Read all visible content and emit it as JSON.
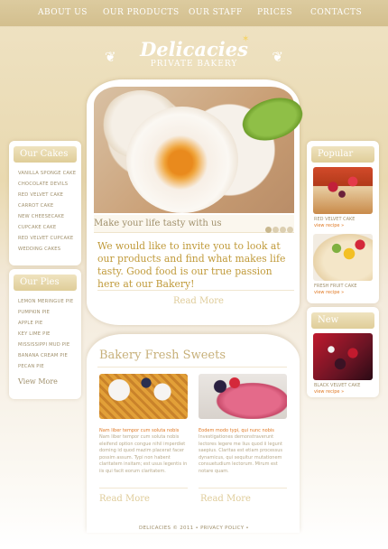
{
  "nav": [
    "ABOUT US",
    "OUR PRODUCTS",
    "OUR STAFF",
    "PRICES",
    "CONTACTS"
  ],
  "logo": {
    "title": "Delicacies",
    "subtitle": "PRIVATE BAKERY"
  },
  "cakes": {
    "heading": "Our Cakes",
    "items": [
      "VANILLA SPONGE CAKE",
      "CHOCOLATE DEVILS",
      "RED VELVET CAKE",
      "CARROT CAKE",
      "NEW CHEESECAKE",
      "CUPCAKE CAKE",
      "RED VELVET CUPCAKE",
      "WEDDING CAKES"
    ]
  },
  "pies": {
    "heading": "Our Pies",
    "items": [
      "LEMON MERINGUE PIE",
      "PUMPKIN PIE",
      "APPLE PIE",
      "KEY LIME PIE",
      "MISSISSIPPI MUD PIE",
      "BANANA CREAM PIE",
      "PECAN PIE"
    ],
    "more": "View More"
  },
  "popular": {
    "heading": "Popular",
    "items": [
      {
        "caption": "RED VELVET CAKE",
        "link": "view recipe »"
      },
      {
        "caption": "FRESH FRUIT CAKE",
        "link": "view recipe »"
      }
    ]
  },
  "new": {
    "heading": "New",
    "items": [
      {
        "caption": "BLACK VELVET CAKE",
        "link": "view recipe »"
      }
    ]
  },
  "hero": {
    "tagline": "Make your life tasty with us",
    "intro": "We would like to invite you to look at our products and find what makes life tasty. Good food is our true passion here at our Bakery!",
    "read_more": "Read More"
  },
  "sweets": {
    "heading": "Bakery Fresh Sweets",
    "items": [
      {
        "title": "Nam liber tempor cum soluta nobis",
        "text": "Nam liber tempor cum soluta nobis eleifend option congue nihil imperdiet doming id quod mazim placerat facer possim assum. Typi non habent claritatem insitam; est usus legentis in iis qui facit eorum claritatem.",
        "read_more": "Read More"
      },
      {
        "title": "Eodem modo typi, qui nunc nobis",
        "text": "Investigationes demonstraverunt lectores legere me lius quod ii legunt saepius. Claritas est etiam processus dynamicus, qui sequitur mutationem consuetudium lectorum. Mirum est notare quam.",
        "read_more": "Read More"
      }
    ]
  },
  "footer": "DELICACIES © 2011 • PRIVACY POLICY •"
}
